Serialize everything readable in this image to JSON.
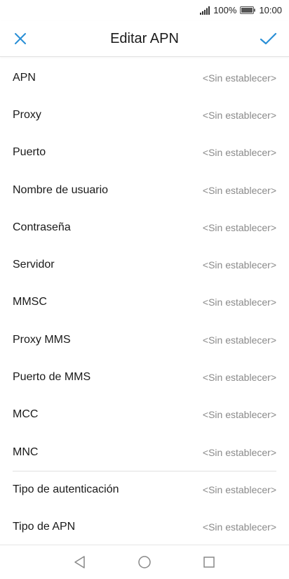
{
  "status_bar": {
    "battery": "100%",
    "time": "10:00",
    "icons": [
      "signal-icon",
      "battery-icon"
    ]
  },
  "app_bar": {
    "title": "Editar APN",
    "close_icon": "close-icon",
    "confirm_icon": "check-icon"
  },
  "fields": [
    {
      "label": "APN",
      "value": "<Sin establecer>"
    },
    {
      "label": "Proxy",
      "value": "<Sin establecer>"
    },
    {
      "label": "Puerto",
      "value": "<Sin establecer>"
    },
    {
      "label": "Nombre de usuario",
      "value": "<Sin establecer>"
    },
    {
      "label": "Contraseña",
      "value": "<Sin establecer>"
    },
    {
      "label": "Servidor",
      "value": "<Sin establecer>"
    },
    {
      "label": "MMSC",
      "value": "<Sin establecer>"
    },
    {
      "label": "Proxy MMS",
      "value": "<Sin establecer>"
    },
    {
      "label": "Puerto de MMS",
      "value": "<Sin establecer>"
    },
    {
      "label": "MCC",
      "value": "<Sin establecer>"
    },
    {
      "label": "MNC",
      "value": "<Sin establecer>"
    },
    {
      "label": "Tipo de autenticación",
      "value": "<Sin establecer>"
    },
    {
      "label": "Tipo de APN",
      "value": "<Sin establecer>"
    }
  ],
  "nav_bar": {
    "icons": [
      "back-icon",
      "home-icon",
      "recents-icon"
    ]
  },
  "colors": {
    "accent": "#2a8fd6",
    "value_text": "#8a8a8a",
    "divider": "#e0e0e0"
  }
}
